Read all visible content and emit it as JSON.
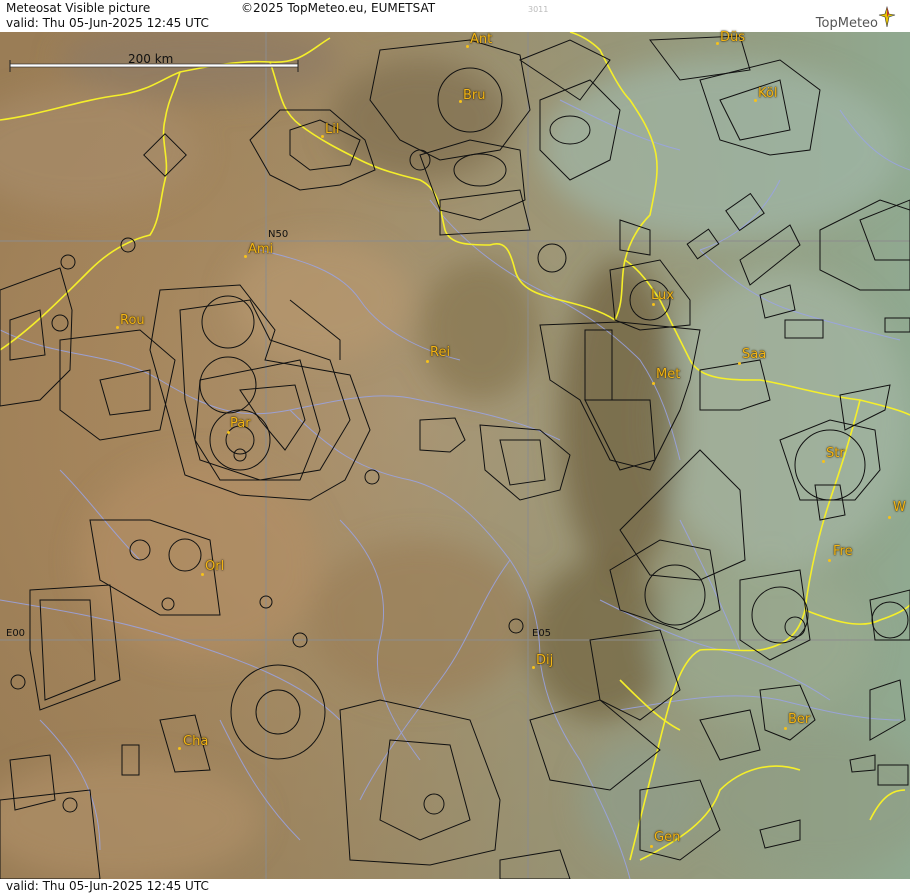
{
  "header": {
    "title": "Meteosat Visible picture",
    "valid": "valid:  Thu  05-Jun-2025  12:45 UTC",
    "copyright": "©2025 TopMeteo.eu, EUMETSAT",
    "code": "3011",
    "logo": "TopMeteo"
  },
  "footer": {
    "valid": "valid:  Thu  05-Jun-2025  12:45 UTC"
  },
  "scale": {
    "label": "200 km"
  },
  "grid": {
    "n50": "N50",
    "e00": "E00",
    "e05": "E05"
  },
  "cities": [
    {
      "id": "ant",
      "label": "Ant"
    },
    {
      "id": "dus",
      "label": "Düs"
    },
    {
      "id": "bru",
      "label": "Bru"
    },
    {
      "id": "kol",
      "label": "Köl"
    },
    {
      "id": "lil",
      "label": "Lil"
    },
    {
      "id": "ami",
      "label": "Ami"
    },
    {
      "id": "rou",
      "label": "Rou"
    },
    {
      "id": "lux",
      "label": "Lux"
    },
    {
      "id": "rei",
      "label": "Rei"
    },
    {
      "id": "saa",
      "label": "Saa"
    },
    {
      "id": "met",
      "label": "Met"
    },
    {
      "id": "par",
      "label": "Par"
    },
    {
      "id": "str",
      "label": "Str"
    },
    {
      "id": "w",
      "label": "W"
    },
    {
      "id": "fre",
      "label": "Fre"
    },
    {
      "id": "orl",
      "label": "Orl"
    },
    {
      "id": "dij",
      "label": "Dij"
    },
    {
      "id": "ber",
      "label": "Ber"
    },
    {
      "id": "cha",
      "label": "Cha"
    },
    {
      "id": "gen",
      "label": "Gen"
    }
  ],
  "colors": {
    "border": "#f5ef2a",
    "airspace": "#111111",
    "river": "#9aa4e6",
    "grid": "#8c8c8c",
    "city": "#f3b515"
  }
}
